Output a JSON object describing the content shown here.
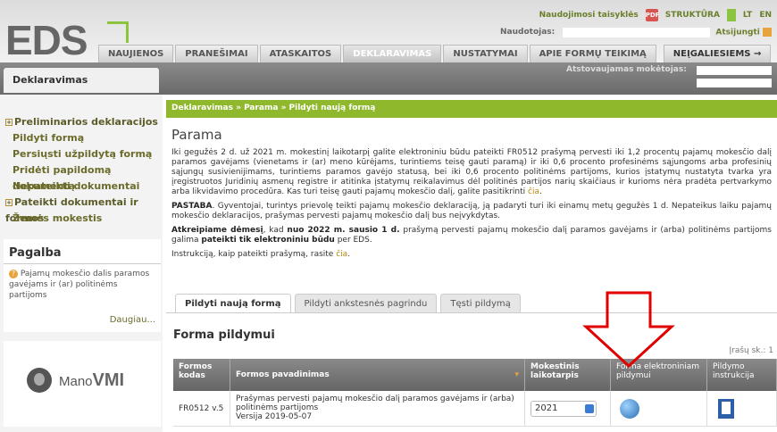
{
  "header": {
    "logo": "EDS",
    "links": {
      "rules": "Naudojimosi taisyklės",
      "structure": "STRUKTŪRA",
      "lang_lt": "LT",
      "lang_en": "EN"
    },
    "user_label": "Naudotojas:",
    "logout": "Atsijungti",
    "rep_label": "Atstovaujamas mokėtojas:"
  },
  "nav": {
    "tabs": [
      "NAUJIENOS",
      "PRANEŠIMAI",
      "ATASKAITOS",
      "DEKLARAVIMAS",
      "NUSTATYMAI",
      "APIE FORMŲ TEIKIMĄ"
    ],
    "active": "DEKLARAVIMAS",
    "right_tab": "NEĮGALIESIEMS →"
  },
  "sidebar": {
    "section_tab": "Deklaravimas",
    "menu": [
      {
        "label": "Preliminarios deklaracijos",
        "expand": true
      },
      {
        "label": "Pildyti formą",
        "expand": false
      },
      {
        "label": "Persiųsti užpildytą formą",
        "expand": false
      },
      {
        "label": "Pridėti papildomą dokumentą",
        "expand": false
      },
      {
        "label": "Nepateikti dokumentai",
        "expand": false
      },
      {
        "label": "Pateikti dokumentai ir formos",
        "expand": true
      },
      {
        "label": "Žemės mokestis",
        "expand": false
      }
    ],
    "help": {
      "title": "Pagalba",
      "text": "Pajamų mokesčio dalis paramos gavėjams ir (ar) politinėms partijoms",
      "more": "Daugiau..."
    },
    "vmi": {
      "text_a": "Mano",
      "text_b": "VMI"
    }
  },
  "main": {
    "breadcrumb": "Deklaravimas » Parama » Pildyti naują formą",
    "title": "Parama",
    "p1": "Iki gegužės 2 d. už 2021 m. mokestinį laikotarpį galite elektroniniu būdu pateikti FR0512 prašymą pervesti iki 1,2 procentų pajamų mokesčio dalį paramos gavėjams (vienetams ir (ar) meno kūrėjams, turintiems teisę gauti paramą) ir iki 0,6 procento profesinėms sąjungoms arba profesinių sąjungų susivienijimams, turintiems paramos gavėjo statusą, bei iki 0,6 procento politinėms partijoms, kurios įstatymų nustatyta tvarka yra įregistruotos Juridinių asmenų registre ir atitinka įstatymų reikalavimus dėl politinės partijos narių skaičiaus ir kurioms nėra pradėta pertvarkymo arba likvidavimo procedūra. Kas turi teisę gauti pajamų mokesčio dalį, galite pasitikrinti",
    "p1_link": "čia",
    "p2_bold": "PASTABA",
    "p2": ". Gyventojai, turintys prievolę teikti pajamų mokesčio deklaraciją, ją padaryti turi iki einamų metų gegužės 1 d. Nepateikus laiku pajamų mokesčio deklaracijos, prašymas pervesti pajamų mokesčio dalį bus neįvykdytas.",
    "p3_a": "Atkreipiame dėmesį",
    "p3_b": ", kad ",
    "p3_c": "nuo 2022 m. sausio 1 d.",
    "p3_d": " prašymą pervesti pajamų mokesčio dalį paramos gavėjams ir (arba) politinėms partijoms galima ",
    "p3_e": "pateikti tik elektroniniu būdu",
    "p3_f": " per EDS.",
    "p4": "Instrukciją, kaip pateikti prašymą, rasite",
    "p4_link": "čia",
    "tabs": [
      "Pildyti naują formą",
      "Pildyti ankstesnės pagrindu",
      "Tęsti pildymą"
    ],
    "form_title": "Forma pildymui",
    "records": "Įrašų sk.: 1",
    "table": {
      "headers": [
        "Formos kodas",
        "Formos pavadinimas",
        "Mokestinis laikotarpis",
        "Forma elektroniniam pildymui",
        "Pildymo instrukcija"
      ],
      "row": {
        "code": "FR0512 v.5",
        "name": "Prašymas pervesti pajamų mokesčio dalį paramos gavėjams ir (arba) politinėms partijoms",
        "version": "Versija 2019-05-07",
        "period": "2021"
      }
    }
  },
  "colors": {
    "green": "#8fb82c",
    "arrow": "#e00000"
  }
}
